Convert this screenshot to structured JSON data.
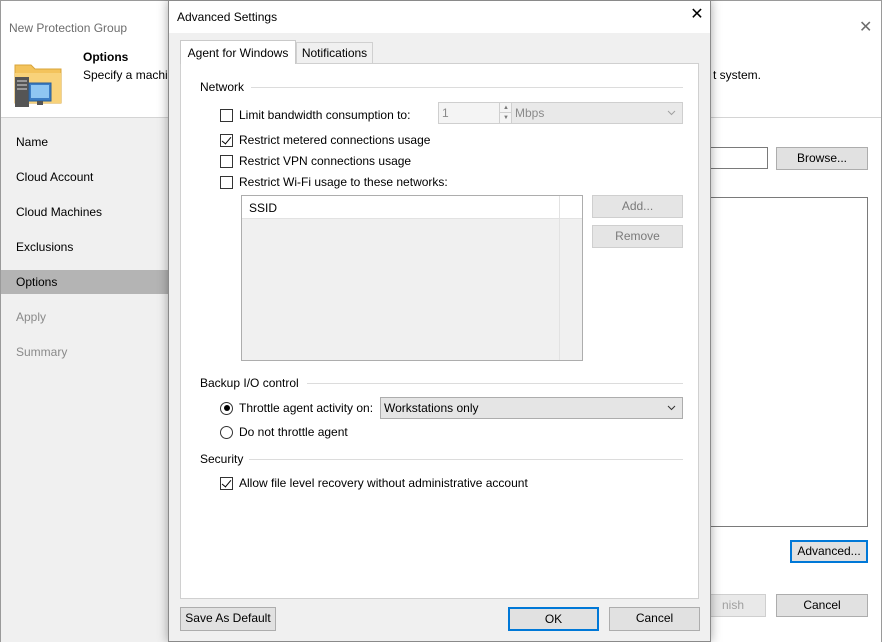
{
  "wizard": {
    "title": "New Protection Group",
    "close_glyph": "✕",
    "header": {
      "title": "Options",
      "description": "Specify a machin",
      "description_tail": "t system."
    },
    "nav": [
      {
        "label": "Name",
        "state": "normal"
      },
      {
        "label": "Cloud Account",
        "state": "normal"
      },
      {
        "label": "Cloud Machines",
        "state": "normal"
      },
      {
        "label": "Exclusions",
        "state": "normal"
      },
      {
        "label": "Options",
        "state": "active"
      },
      {
        "label": "Apply",
        "state": "disabled"
      },
      {
        "label": "Summary",
        "state": "disabled"
      }
    ],
    "buttons": {
      "browse": "Browse...",
      "advanced": "Advanced...",
      "finish": "nish",
      "cancel": "Cancel"
    }
  },
  "dialog": {
    "title": "Advanced Settings",
    "close_glyph": "✕",
    "tabs": [
      {
        "label": "Agent for Windows",
        "active": true
      },
      {
        "label": "Notifications",
        "active": false
      }
    ],
    "network": {
      "heading": "Network",
      "limit_bandwidth": {
        "label": "Limit bandwidth consumption to:",
        "checked": false,
        "value": "1",
        "unit": "Mbps"
      },
      "restrict_metered": {
        "label": "Restrict metered connections usage",
        "checked": true
      },
      "restrict_vpn": {
        "label": "Restrict VPN connections usage",
        "checked": false
      },
      "restrict_wifi": {
        "label": "Restrict Wi-Fi usage to these networks:",
        "checked": false
      },
      "ssid_column": "SSID",
      "add_button": "Add...",
      "remove_button": "Remove"
    },
    "backup_io": {
      "heading": "Backup I/O control",
      "throttle": {
        "label": "Throttle agent activity on:",
        "selected": true,
        "value": "Workstations only"
      },
      "no_throttle": {
        "label": "Do not throttle agent",
        "selected": false
      }
    },
    "security": {
      "heading": "Security",
      "allow_flr": {
        "label": "Allow file level recovery without administrative account",
        "checked": true
      }
    },
    "buttons": {
      "save_default": "Save As Default",
      "ok": "OK",
      "cancel": "Cancel"
    }
  },
  "colors": {
    "accent": "#0078d7",
    "nav_active": "#b4b4b4",
    "dialog_bg": "#f0f0f0"
  }
}
